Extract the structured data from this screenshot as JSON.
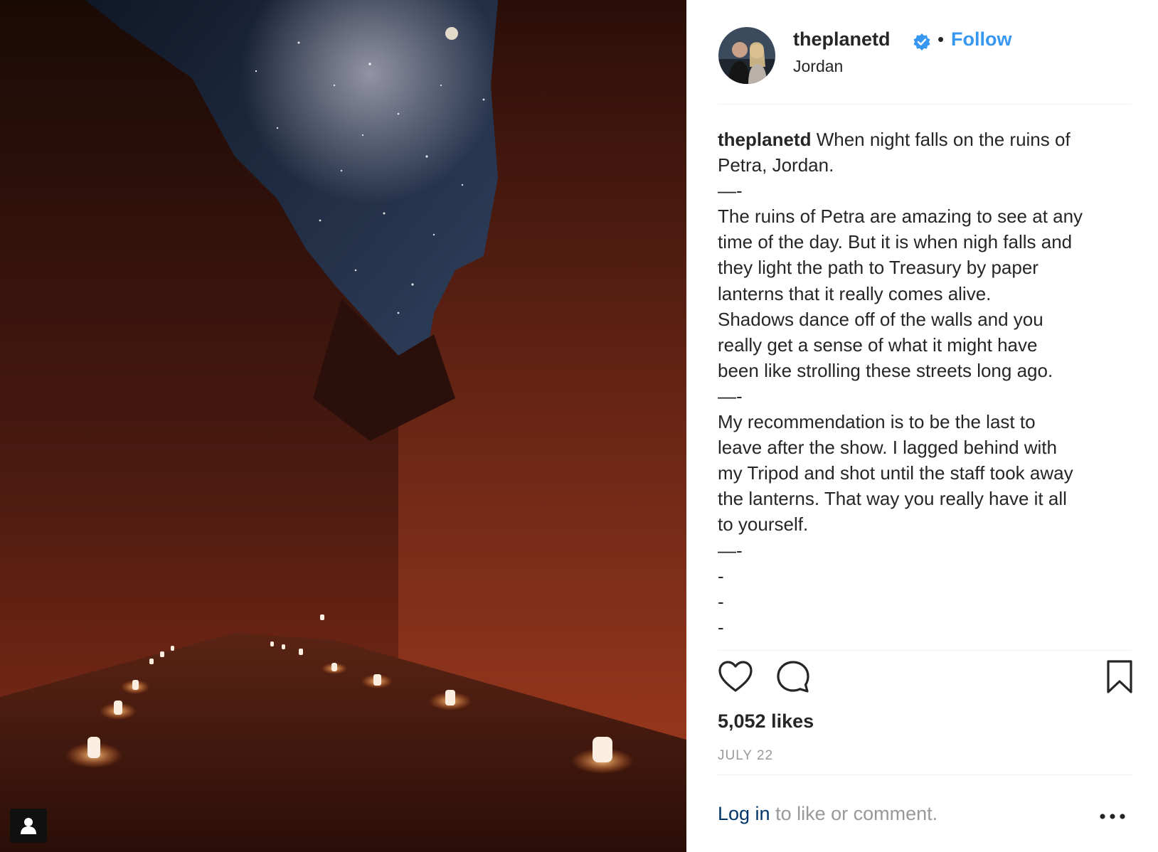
{
  "post": {
    "username": "theplanetd",
    "verified": true,
    "separator": "•",
    "follow_label": "Follow",
    "location": "Jordan",
    "caption_author": "theplanetd",
    "caption_lines": [
      "When night falls on the ruins of",
      "Petra, Jordan.",
      "—-",
      "The ruins of Petra are amazing to see at any",
      "time of the day. But it is when nigh falls and",
      "they light the path to Treasury by paper",
      "lanterns that it really comes alive.",
      "Shadows dance off of the walls and you",
      "really get a sense of what it might have",
      "been like strolling these streets long ago.",
      "—-",
      "My recommendation is to be the last to",
      "leave after the show. I lagged behind with",
      "my Tripod and shot until the staff took away",
      "the lanterns. That way you really have it all",
      "to yourself.",
      "—-",
      "-",
      "-",
      "-"
    ],
    "likes": "5,052 likes",
    "date": "JULY 22",
    "login_link": "Log in",
    "login_rest": " to like or comment."
  },
  "icons": {
    "like": "heart-outline-icon",
    "comment": "speech-bubble-icon",
    "save": "bookmark-icon",
    "more": "more-horizontal-icon",
    "verified": "verified-badge-icon",
    "user_tag": "user-tag-icon"
  },
  "colors": {
    "link_blue": "#3897f0",
    "login_blue": "#003569",
    "text": "#262626",
    "muted": "#999999",
    "divider": "#efefef"
  }
}
